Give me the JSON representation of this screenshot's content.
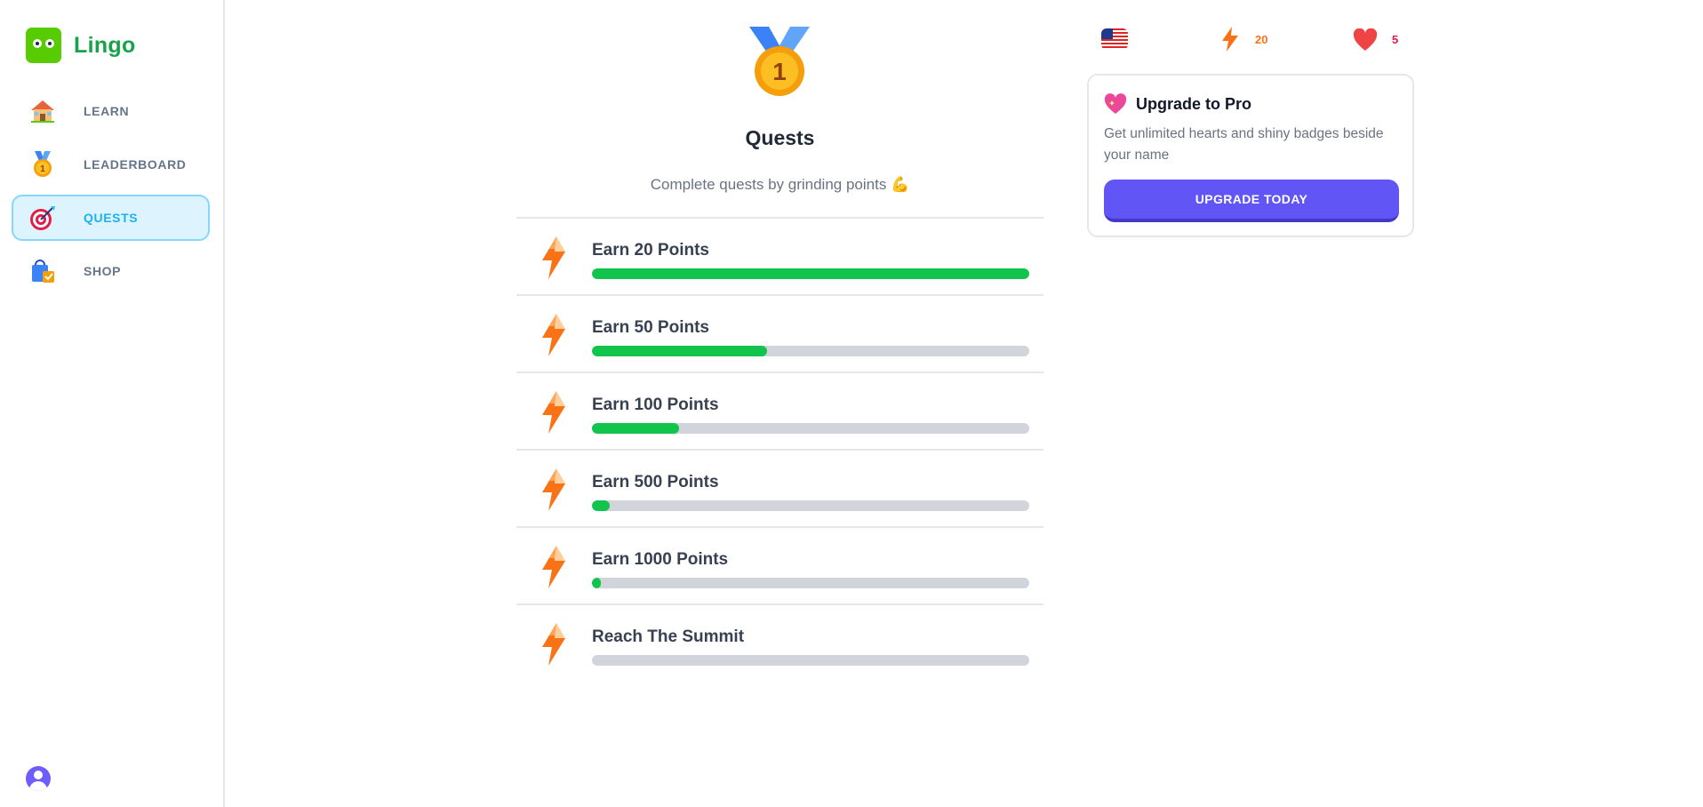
{
  "brand": {
    "name": "Lingo"
  },
  "sidebar": {
    "items": [
      {
        "label": "LEARN",
        "icon": "house-icon",
        "active": false
      },
      {
        "label": "LEADERBOARD",
        "icon": "medal-icon",
        "active": false
      },
      {
        "label": "QUESTS",
        "icon": "target-icon",
        "active": true
      },
      {
        "label": "SHOP",
        "icon": "shopping-bag-icon",
        "active": false
      }
    ],
    "user_icon": "user-avatar-icon"
  },
  "header_stats": {
    "flag_icon": "us-flag-icon",
    "points": "20",
    "hearts": "5"
  },
  "page": {
    "medal_number": "1",
    "title": "Quests",
    "subtitle": "Complete quests by grinding points 💪"
  },
  "quests": [
    {
      "title": "Earn 20 Points",
      "progress": 1.0
    },
    {
      "title": "Earn 50 Points",
      "progress": 0.4
    },
    {
      "title": "Earn 100 Points",
      "progress": 0.2
    },
    {
      "title": "Earn 500 Points",
      "progress": 0.04
    },
    {
      "title": "Earn 1000 Points",
      "progress": 0.02
    },
    {
      "title": "Reach The Summit",
      "progress": 0.0
    }
  ],
  "promo": {
    "title": "Upgrade to Pro",
    "text": "Get unlimited hearts and shiny badges beside your name",
    "button_label": "UPGRADE TODAY"
  },
  "colors": {
    "progress_fill": "#10c44c",
    "progress_track": "#d1d5db",
    "accent": "#6155f5",
    "active_nav": "#1cb0f6"
  }
}
